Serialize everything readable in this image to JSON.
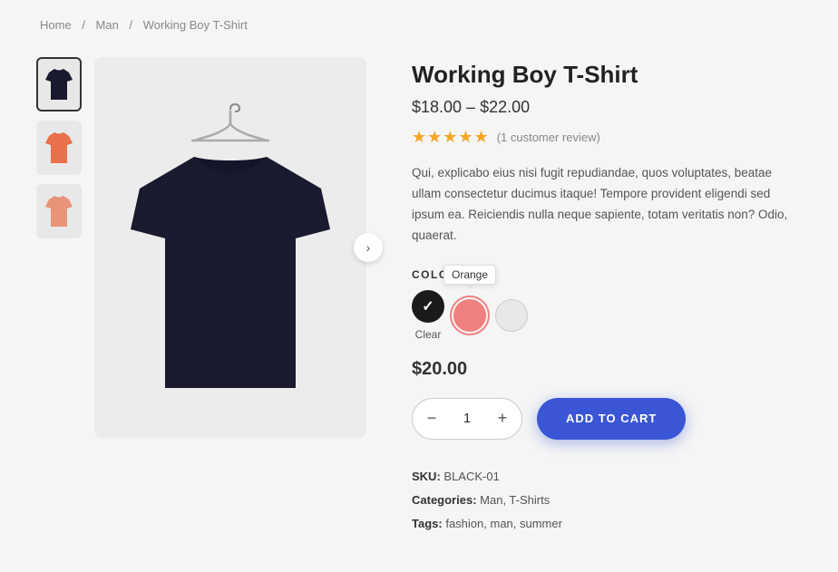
{
  "breadcrumb": {
    "items": [
      "Home",
      "Man",
      "Working Boy T-Shirt"
    ],
    "separators": [
      "/",
      "/"
    ]
  },
  "product": {
    "title": "Working Boy T-Shirt",
    "price_range": "$18.00 – $22.00",
    "selected_price": "$20.00",
    "rating_stars": 5,
    "review_count": "(1 customer review)",
    "description": "Qui, explicabo eius nisi fugit repudiandae, quos voluptates, beatae ullam consectetur ducimus itaque! Tempore provident eligendi sed ipsum ea. Reiciendis nulla neque sapiente, totam veritatis non? Odio, quaerat.",
    "color_label": "COLOR",
    "colors": [
      {
        "name": "Black",
        "hex": "#1a1a1a",
        "selected": true
      },
      {
        "name": "Orange",
        "hex": "#f08080",
        "selected": false,
        "tooltip": "Orange"
      },
      {
        "name": "White",
        "hex": "#e8e8e8",
        "selected": false
      }
    ],
    "clear_label": "Clear",
    "quantity": 1,
    "add_to_cart_label": "ADD TO CART",
    "sku_label": "SKU:",
    "sku_value": "BLACK-01",
    "categories_label": "Categories:",
    "categories_value": "Man, T-Shirts",
    "tags_label": "Tags:",
    "tags_value": "fashion, man, summer"
  },
  "nav_arrow": "›"
}
